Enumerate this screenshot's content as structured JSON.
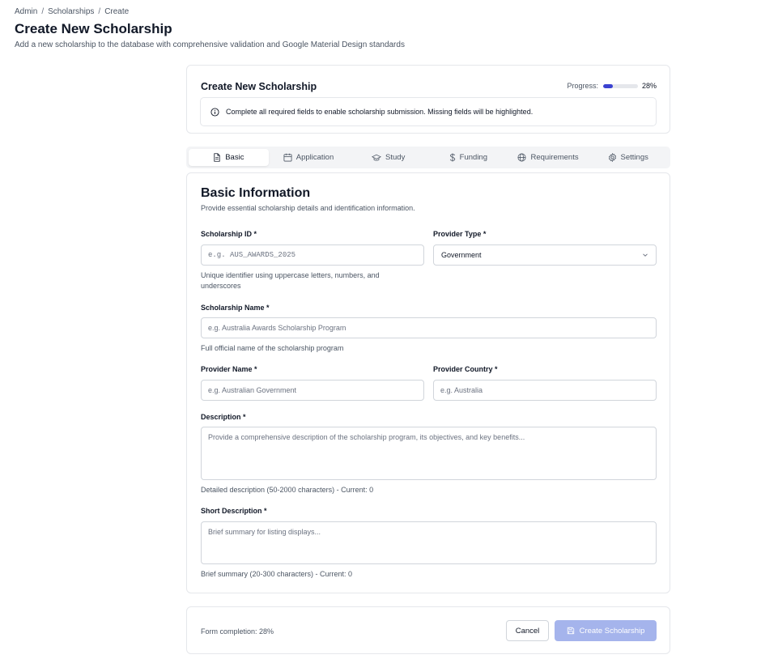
{
  "breadcrumb": {
    "items": [
      "Admin",
      "Scholarships",
      "Create"
    ],
    "separator": "/"
  },
  "page": {
    "title": "Create New Scholarship",
    "subtitle": "Add a new scholarship to the database with comprehensive validation and Google Material Design standards"
  },
  "status_card": {
    "title": "Create New Scholarship",
    "progress_label": "Progress:",
    "progress_value": "28%",
    "progress_fraction": 0.28,
    "alert_icon": "info-icon",
    "alert_text": "Complete all required fields to enable scholarship submission. Missing fields will be highlighted."
  },
  "tabs": [
    {
      "label": "Basic",
      "icon": "document-icon",
      "active": true
    },
    {
      "label": "Application",
      "icon": "calendar-icon",
      "active": false
    },
    {
      "label": "Study",
      "icon": "graduation-cap-icon",
      "active": false
    },
    {
      "label": "Funding",
      "icon": "dollar-icon",
      "active": false
    },
    {
      "label": "Requirements",
      "icon": "globe-icon",
      "active": false
    },
    {
      "label": "Settings",
      "icon": "gear-icon",
      "active": false
    }
  ],
  "form": {
    "section_title": "Basic Information",
    "section_desc": "Provide essential scholarship details and identification information.",
    "scholarship_id": {
      "label": "Scholarship ID *",
      "placeholder": "e.g. AUS_AWARDS_2025",
      "help_line1": "Unique identifier using uppercase letters, numbers, and",
      "help_line2": "underscores"
    },
    "provider_type": {
      "label": "Provider Type *",
      "value": "Government"
    },
    "scholarship_name": {
      "label": "Scholarship Name *",
      "placeholder": "e.g. Australia Awards Scholarship Program",
      "help": "Full official name of the scholarship program"
    },
    "provider_name": {
      "label": "Provider Name *",
      "placeholder": "e.g. Australian Government"
    },
    "provider_country": {
      "label": "Provider Country *",
      "placeholder": "e.g. Australia"
    },
    "description": {
      "label": "Description *",
      "placeholder": "Provide a comprehensive description of the scholarship program, its objectives, and key benefits...",
      "help": "Detailed description (50-2000 characters) - Current: 0"
    },
    "short_description": {
      "label": "Short Description *",
      "placeholder": "Brief summary for listing displays...",
      "help": "Brief summary (20-300 characters) - Current: 0"
    }
  },
  "footer": {
    "completion": "Form completion: 28%",
    "cancel_label": "Cancel",
    "create_label": "Create Scholarship"
  },
  "colors": {
    "accent": "#3b42d1",
    "create_button_disabled": "#a5b4ec",
    "border": "#e5e7eb"
  }
}
